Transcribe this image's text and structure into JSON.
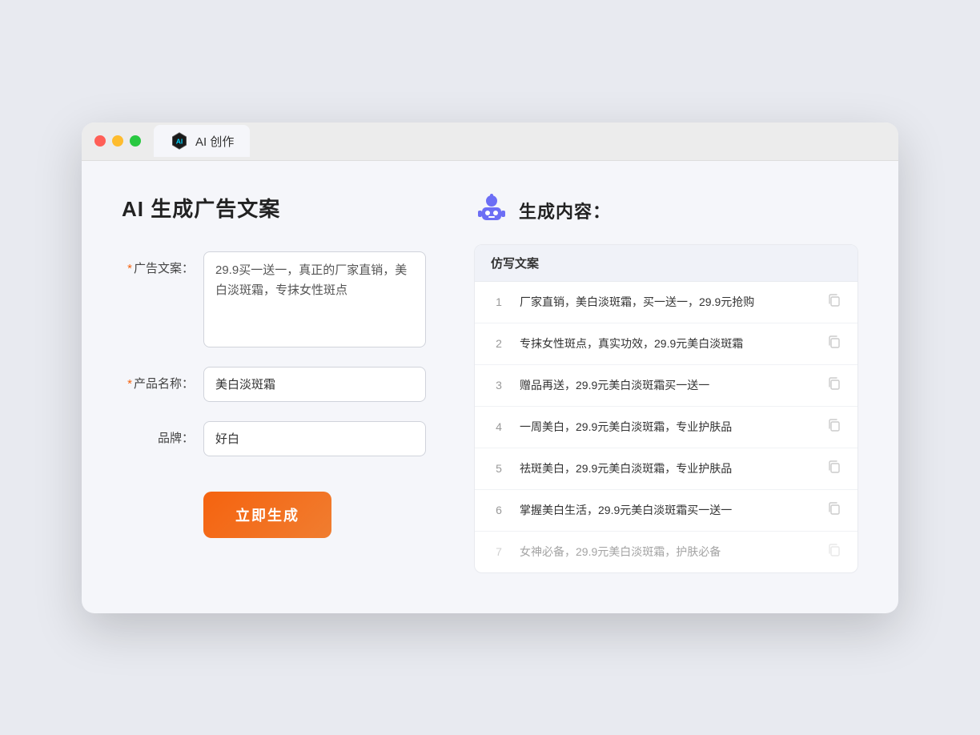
{
  "browser": {
    "tab_label": "AI 创作"
  },
  "page": {
    "title": "AI 生成广告文案"
  },
  "form": {
    "ad_text_label": "广告文案：",
    "ad_text_required": true,
    "ad_text_value": "29.9买一送一，真正的厂家直销，美白淡斑霜，专抹女性斑点",
    "product_name_label": "产品名称：",
    "product_name_required": true,
    "product_name_value": "美白淡斑霜",
    "brand_label": "品牌：",
    "brand_required": false,
    "brand_value": "好白",
    "submit_label": "立即生成"
  },
  "results": {
    "header": "生成内容：",
    "table_header": "仿写文案",
    "items": [
      {
        "id": 1,
        "text": "厂家直销，美白淡斑霜，买一送一，29.9元抢购",
        "faded": false
      },
      {
        "id": 2,
        "text": "专抹女性斑点，真实功效，29.9元美白淡斑霜",
        "faded": false
      },
      {
        "id": 3,
        "text": "赠品再送，29.9元美白淡斑霜买一送一",
        "faded": false
      },
      {
        "id": 4,
        "text": "一周美白，29.9元美白淡斑霜，专业护肤品",
        "faded": false
      },
      {
        "id": 5,
        "text": "祛斑美白，29.9元美白淡斑霜，专业护肤品",
        "faded": false
      },
      {
        "id": 6,
        "text": "掌握美白生活，29.9元美白淡斑霜买一送一",
        "faded": false
      },
      {
        "id": 7,
        "text": "女神必备，29.9元美白淡斑霜，护肤必备",
        "faded": true
      }
    ]
  }
}
